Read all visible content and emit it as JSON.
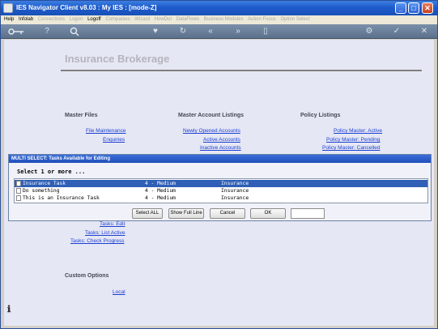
{
  "window": {
    "title": "IES Navigator Client v8.03 : My IES :      [mode-Z]",
    "minimize": "_",
    "maximize": "□",
    "close": "✕"
  },
  "menu": [
    {
      "label": "Help",
      "enabled": true
    },
    {
      "label": "Infolab",
      "enabled": true
    },
    {
      "label": "Connections",
      "enabled": false
    },
    {
      "label": "Logon",
      "enabled": false
    },
    {
      "label": "Logoff",
      "enabled": true
    },
    {
      "label": "Companies",
      "enabled": false
    },
    {
      "label": "Wizard",
      "enabled": false
    },
    {
      "label": "HowDoI",
      "enabled": false
    },
    {
      "label": "DataFlows",
      "enabled": false
    },
    {
      "label": "Business Modules",
      "enabled": false
    },
    {
      "label": "Action Focus",
      "enabled": false
    },
    {
      "label": "Option Select",
      "enabled": false
    }
  ],
  "toolbar": {
    "icons": [
      "key-icon",
      "help-icon",
      "search-icon",
      "heart-icon",
      "refresh-icon",
      "back-icon",
      "forward-icon",
      "clipboard-icon",
      "settings-icon",
      "check-icon",
      "close-icon"
    ]
  },
  "page": {
    "heading": "Insurance Brokerage"
  },
  "master_files": {
    "title": "Master Files",
    "links": [
      "File Maintenance",
      "Enquiries"
    ]
  },
  "master_account_listings": {
    "title": "Master Account Listings",
    "links": [
      "Newly Opened Accounts",
      "Active Accounts",
      "Inactive Accounts"
    ]
  },
  "policy_listings": {
    "title": "Policy Listings",
    "links": [
      "Policy Master: Active",
      "Policy Master: Pending",
      "Policy Master: Cancelled"
    ]
  },
  "tasks": {
    "links": [
      "Tasks: Edit",
      "Tasks: List Active",
      "Tasks: Check Progress"
    ]
  },
  "custom_options": {
    "title": "Custom Options",
    "links": [
      "Local"
    ]
  },
  "dialog": {
    "title": "MULTI SELECT: Tasks Available for Editing",
    "prompt": "Select 1 or more ...",
    "rows": [
      {
        "name": "Insurance Task",
        "priority": "4 - Medium",
        "category": "Insurance",
        "selected": true
      },
      {
        "name": "Do something",
        "priority": "4 - Medium",
        "category": "Insurance",
        "selected": false
      },
      {
        "name": "This is an Insurance Task",
        "priority": "4 - Medium",
        "category": "Insurance",
        "selected": false
      }
    ],
    "buttons": {
      "select_all": "Select ALL",
      "show_full_line": "Show Full Line",
      "cancel": "Cancel",
      "ok": "OK"
    },
    "input_value": ""
  },
  "colors": {
    "title_bar": "#1e5ccc",
    "link": "#1a3fd1",
    "content_bg": "#e6e7f4",
    "selection": "#2f5fb6"
  }
}
